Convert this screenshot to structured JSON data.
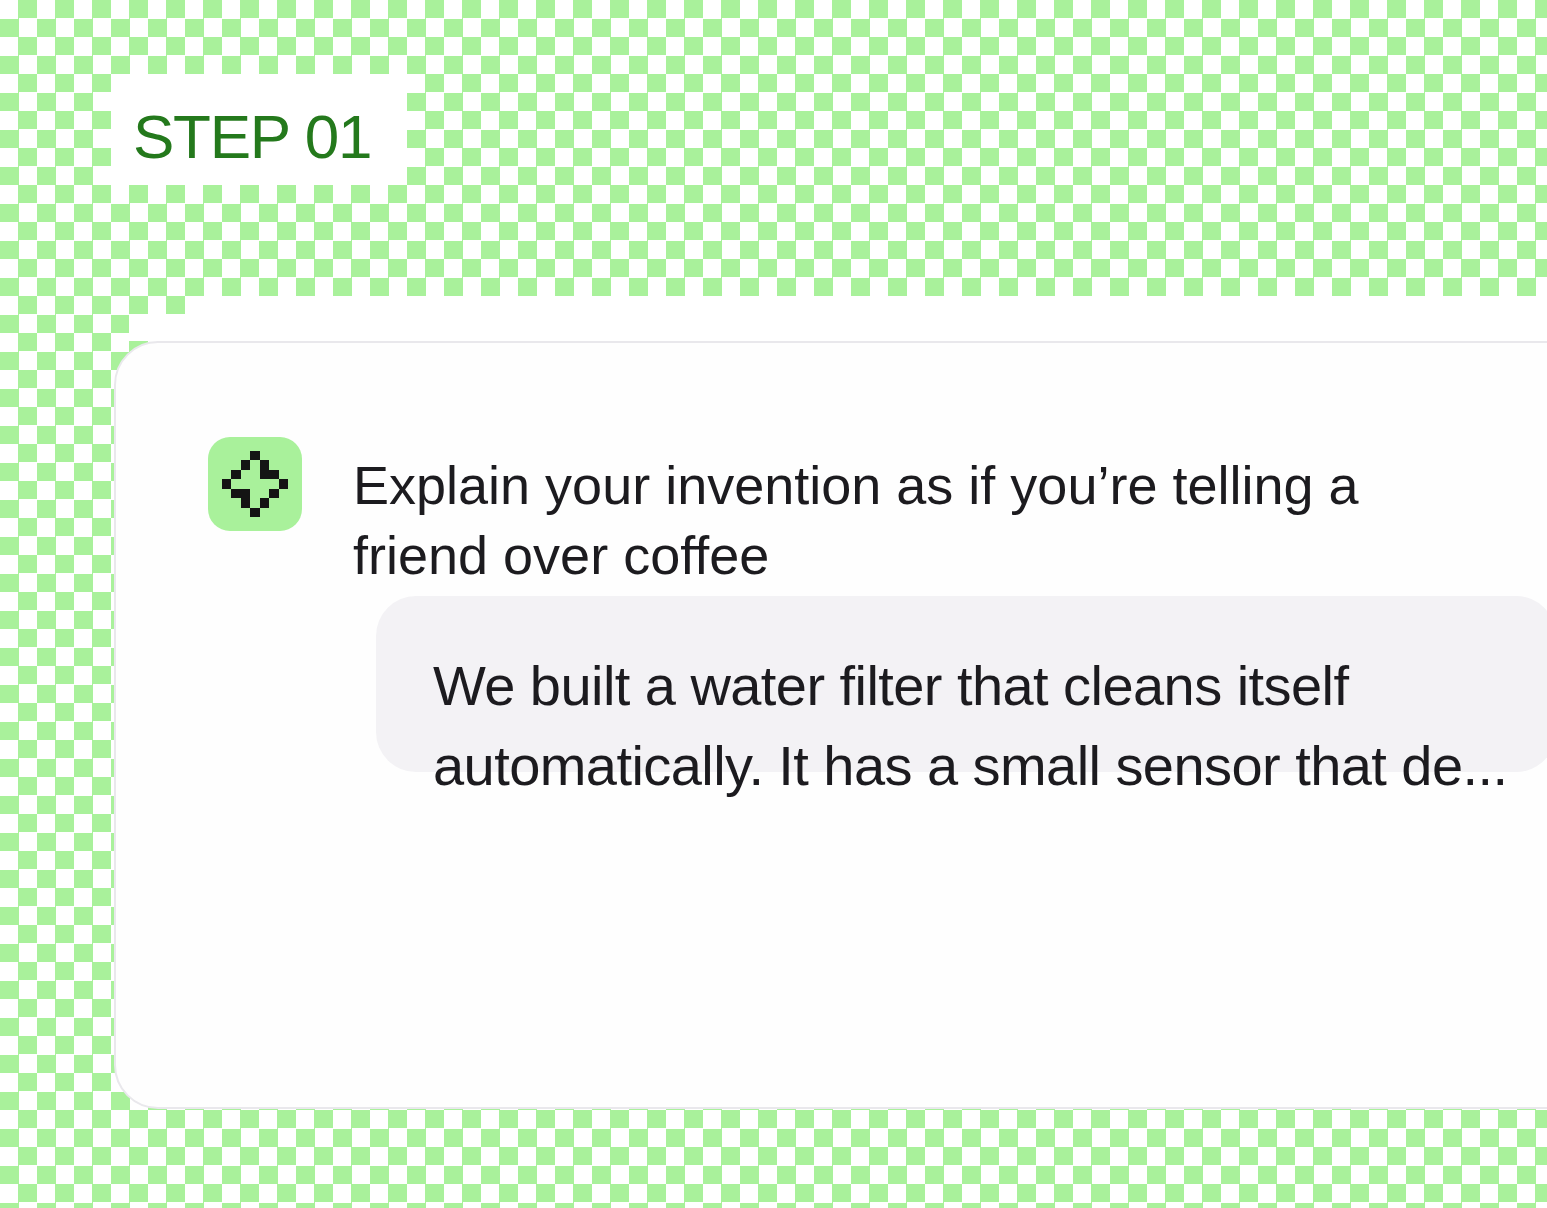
{
  "step_label": "STEP 01",
  "prompt": {
    "text": "Explain your invention as if you’re telling a friend over coffee"
  },
  "answer": {
    "text": "We built a water filter that cleans itself automatically. It has a small sensor that de..."
  }
}
